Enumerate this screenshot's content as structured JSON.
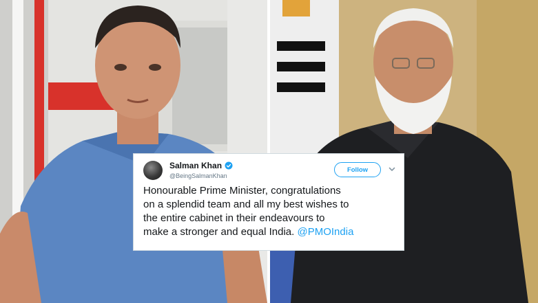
{
  "tweet": {
    "name": "Salman Khan",
    "handle": "@BeingSalmanKhan",
    "follow_label": "Follow",
    "lines": [
      "Honourable Prime Minister, congratulations",
      "on a splendid team and all my best wishes to",
      "the entire cabinet in their endeavours to",
      "make a stronger and equal India."
    ],
    "mention": "@PMOIndia",
    "verified_icon": "verified-badge-icon",
    "accent_color": "#1da1f2"
  }
}
